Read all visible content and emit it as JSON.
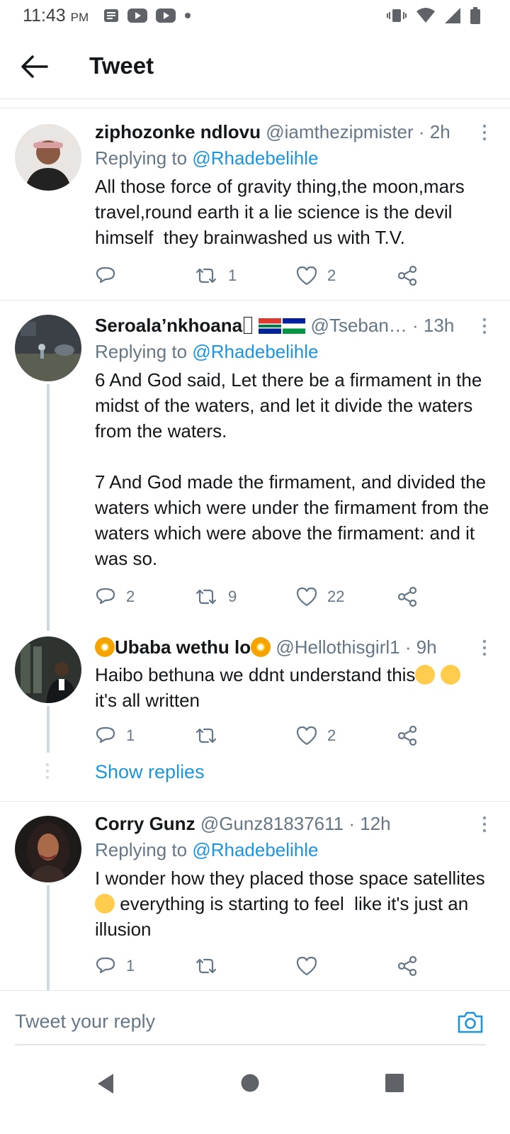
{
  "status_bar": {
    "time": "11:43",
    "ampm": "PM",
    "left_icons": [
      "news-icon",
      "youtube-icon",
      "youtube-icon",
      "notification-dot-icon"
    ],
    "right_icons": [
      "vibrate-icon",
      "wifi-icon",
      "signal-icon",
      "battery-icon"
    ]
  },
  "header": {
    "title": "Tweet",
    "back_icon": "arrow-left-icon"
  },
  "tweets": [
    {
      "name": "ziphozonke ndlovu",
      "handle": "@iamthezipmister",
      "time": "· 2h",
      "replying_prefix": "Replying to",
      "replying_to": "@Rhadebelihle",
      "text": "All those force of gravity thing,the moon,mars travel,round earth it a lie science is the devil himself  they brainwashed us with T.V.",
      "replies": "",
      "retweets": "1",
      "likes": "2"
    },
    {
      "name": "Seroala’nkhoana",
      "handle": "@Tseban…",
      "time": " · 13h",
      "replying_prefix": "Replying to",
      "replying_to": "@Rhadebelihle",
      "text": "6 And God said, Let there be a firmament in the midst of the waters, and let it divide the waters from the waters.\n\n7 And God made the firmament, and divided the waters which were under the firmament from the waters which were above the firmament: and it was so.",
      "replies": "2",
      "retweets": "9",
      "likes": "22"
    },
    {
      "name": "Ubaba wethu lo",
      "handle": "@Hellothisgirl1",
      "time": "· 9h",
      "text_main": "Haibo bethuna we ddnt understand this",
      "text_tail": "it's all written",
      "replies": "1",
      "retweets": "",
      "likes": "2",
      "show_replies": "Show replies"
    },
    {
      "name": "Corry Gunz",
      "handle": "@Gunz81837611",
      "time": "· 12h",
      "replying_prefix": "Replying to",
      "replying_to": "@Rhadebelihle",
      "text_a": "I wonder how they placed those space satellites",
      "text_b": "everything is starting to feel  like it's just an illusion",
      "replies": "1",
      "retweets": "",
      "likes": ""
    }
  ],
  "reply_bar": {
    "placeholder": "Tweet your reply",
    "camera_icon": "camera-icon"
  },
  "nav_bar": {
    "icons": [
      "back-triangle-icon",
      "home-circle-icon",
      "recents-square-icon"
    ]
  },
  "colors": {
    "accent": "#1b95e0",
    "secondary_text": "#657786",
    "divider": "#e1e8ed"
  }
}
